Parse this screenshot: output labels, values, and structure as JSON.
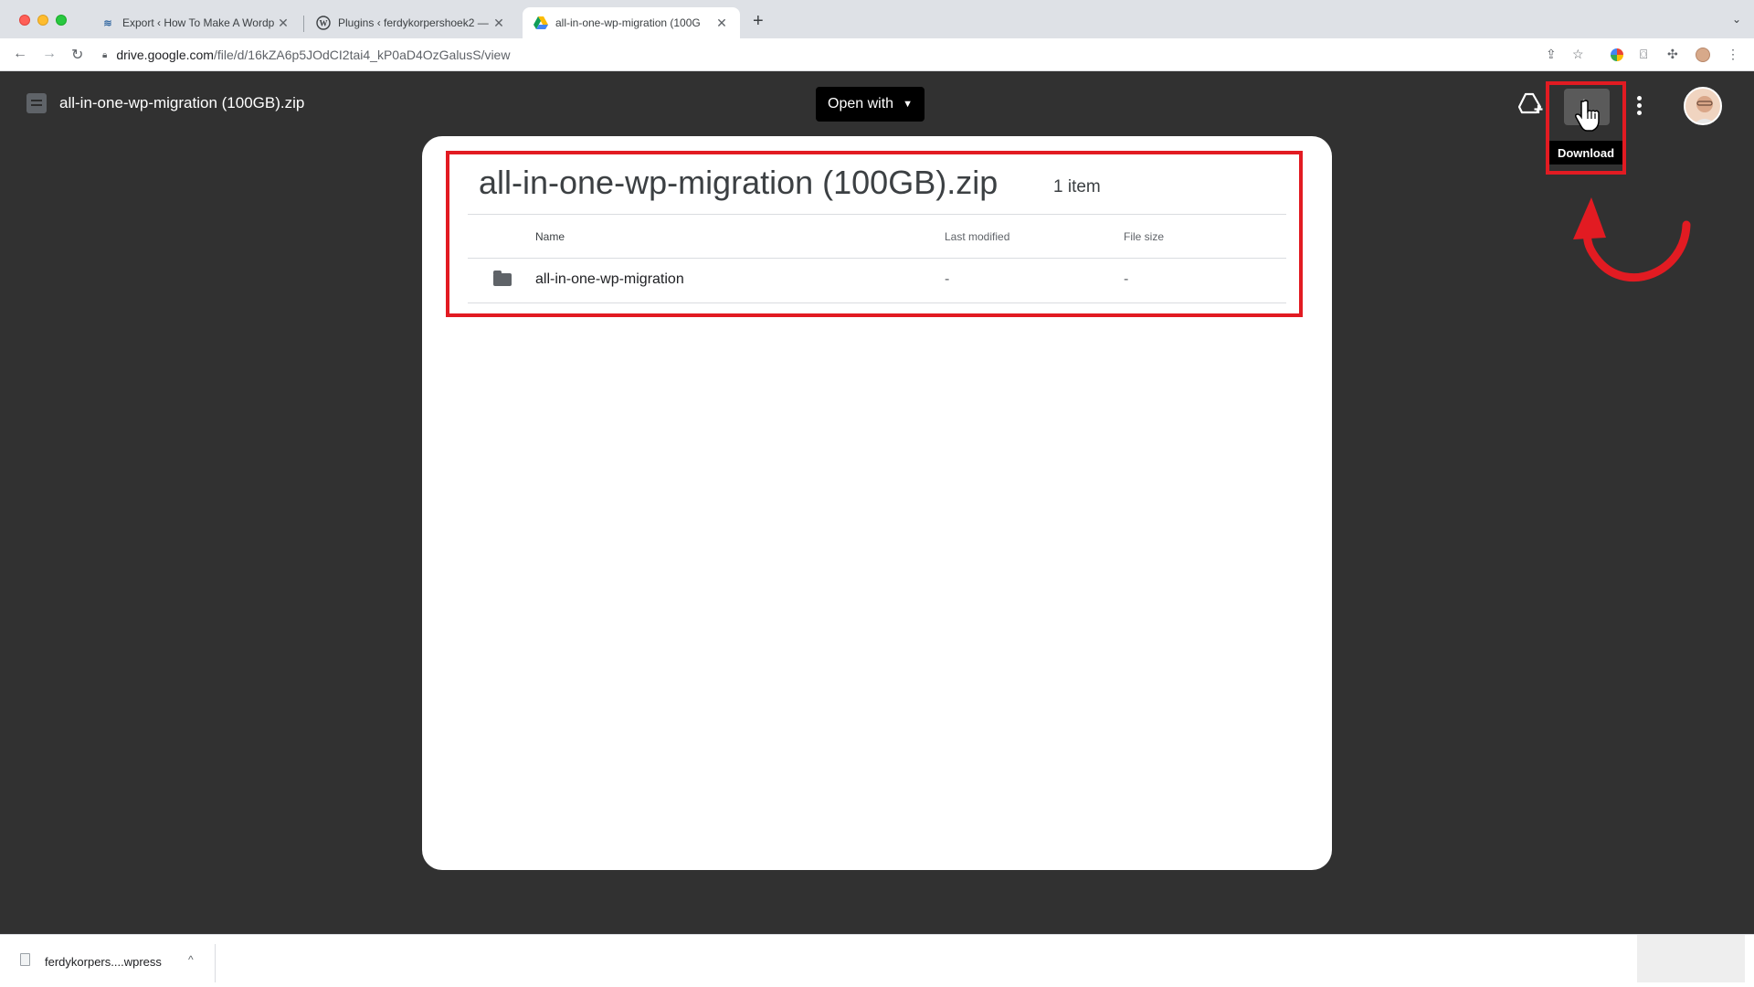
{
  "browser": {
    "tabs": [
      {
        "title": "Export ‹ How To Make A Wordp",
        "favicon": "waves-icon",
        "active": false
      },
      {
        "title": "Plugins ‹ ferdykorpershoek2 —",
        "favicon": "wordpress-icon",
        "active": false
      },
      {
        "title": "all-in-one-wp-migration (100G",
        "favicon": "google-drive-icon",
        "active": true
      }
    ],
    "close_glyph": "✕",
    "new_tab_glyph": "+",
    "address": {
      "host": "drive.google.com",
      "path": "/file/d/16kZA6p5JOdCI2tai4_kP0aD4OzGalusS/view"
    }
  },
  "viewer": {
    "file_name": "all-in-one-wp-migration (100GB).zip",
    "open_with_label": "Open with",
    "download_tooltip": "Download"
  },
  "archive": {
    "title": "all-in-one-wp-migration (100GB).zip",
    "count": "1 item",
    "columns": [
      "Name",
      "Last modified",
      "File size"
    ],
    "rows": [
      {
        "name": "all-in-one-wp-migration",
        "modified": "-",
        "size": "-",
        "icon": "folder-icon"
      }
    ]
  },
  "annotations": {
    "highlight_color": "#e21b22",
    "arrow_color": "#e21b22"
  },
  "download_shelf": {
    "file_name": "ferdykorpers....wpress",
    "caret": "^"
  }
}
